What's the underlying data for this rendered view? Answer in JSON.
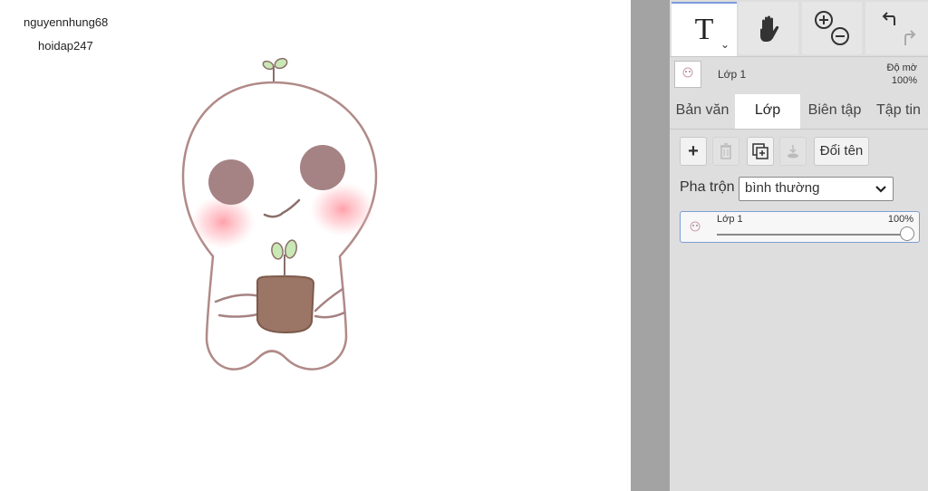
{
  "canvas": {
    "signature_line1": "nguyennhung68",
    "signature_line2": "hoidap247"
  },
  "toolbar": {
    "text_tool": "T",
    "tools": [
      "text-tool",
      "hand-tool",
      "zoom-tool",
      "undo-redo"
    ]
  },
  "layer_info": {
    "name": "Lớp 1",
    "opacity_label": "Độ mờ",
    "opacity_value": "100%"
  },
  "tabs": [
    {
      "label": "Bản văn",
      "active": false
    },
    {
      "label": "Lớp",
      "active": true
    },
    {
      "label": "Biên tập",
      "active": false
    },
    {
      "label": "Tập tin",
      "active": false
    }
  ],
  "layer_buttons": {
    "rename_label": "Đổi tên"
  },
  "blend": {
    "label": "Pha trộn",
    "selected": "bình thường"
  },
  "layer_list": [
    {
      "name": "Lớp 1",
      "opacity": "100%",
      "opacity_fraction": 1.0
    }
  ],
  "colors": {
    "accent": "#7a9bd8",
    "panel_bg": "#dedede",
    "divider": "#a3a3a3"
  }
}
